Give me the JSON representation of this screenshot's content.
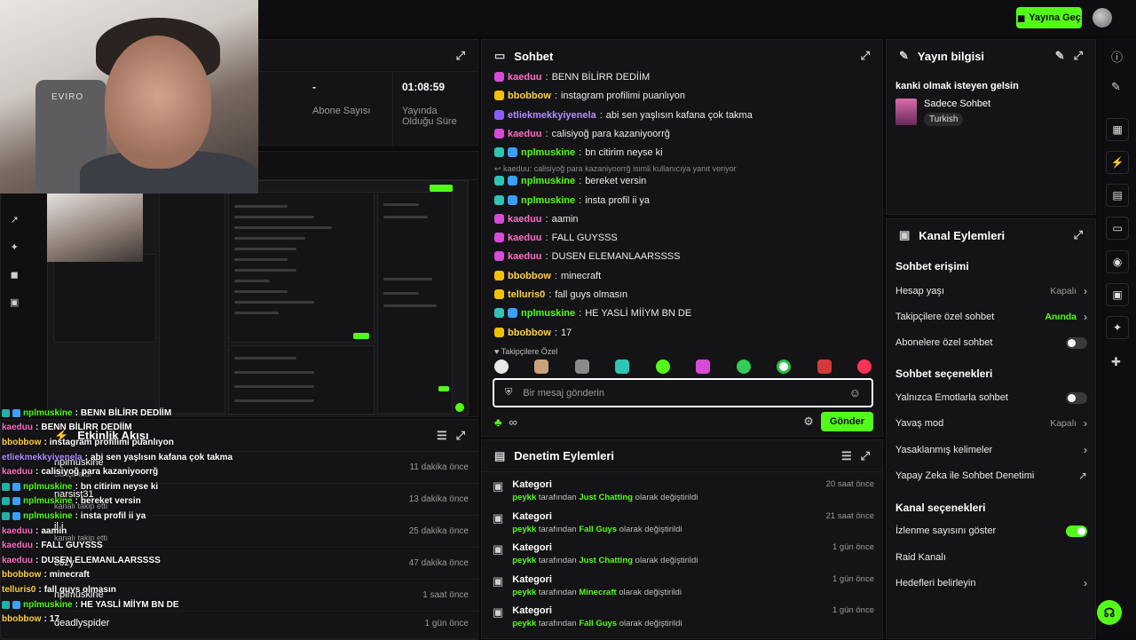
{
  "topbar": {
    "live_label": "Yayına Geç"
  },
  "webcam": {
    "chair_text": "EVIRO"
  },
  "stats": {
    "items": [
      {
        "value": "-",
        "label": "Abone Sayısı"
      },
      {
        "value": "01:08:59",
        "label": "Yayında Olduğu Süre"
      }
    ]
  },
  "activity": {
    "title": "Etkinlik Akışı",
    "rows": [
      {
        "user": "nplmuskine",
        "sub": "Su içir aldı",
        "time": "11 dakika önce"
      },
      {
        "user": "narsist31",
        "sub": "kanalı takip etti",
        "time": "13 dakika önce"
      },
      {
        "user": "il i",
        "sub": "kanalı takip etti",
        "time": "25 dakika önce"
      },
      {
        "user": "cozy",
        "sub": "",
        "time": "47 dakika önce"
      },
      {
        "user": "nplmuskine",
        "sub": "",
        "time": "1 saat önce"
      },
      {
        "user": "deadlyspider",
        "sub": "",
        "time": "1 gün önce"
      }
    ]
  },
  "overlay_chat": [
    {
      "user": "nplmuskine",
      "text": "BENN BİLİRR DEDİİM",
      "color": "#53fc18"
    },
    {
      "user": "kaeduu",
      "text": "BENN BİLİRR DEDİİM",
      "color": "#ff6ec7"
    },
    {
      "user": "bbobbow",
      "text": "instagram profilimi puanlıyon",
      "color": "#ffd24a"
    },
    {
      "user": "etliekmekkyiyenela",
      "text": "abi sen yaşlısın kafana çok takma",
      "color": "#b48cff"
    },
    {
      "user": "kaeduu",
      "text": "calisiyoğ para kazaniyoorrğ",
      "color": "#ff6ec7"
    },
    {
      "user": "nplmuskine",
      "text": "bn citirim neyse ki",
      "color": "#53fc18"
    },
    {
      "user": "nplmuskine",
      "text": "bereket versin",
      "color": "#53fc18"
    },
    {
      "user": "nplmuskine",
      "text": "insta profil ii ya",
      "color": "#53fc18"
    },
    {
      "user": "kaeduu",
      "text": "aamin",
      "color": "#ff6ec7"
    },
    {
      "user": "kaeduu",
      "text": "FALL GUYSSS",
      "color": "#ff6ec7"
    },
    {
      "user": "kaeduu",
      "text": "DUSEN ELEMANLAARSSSS",
      "color": "#ff6ec7"
    },
    {
      "user": "bbobbow",
      "text": "minecraft",
      "color": "#ffd24a"
    },
    {
      "user": "telluris0",
      "text": "fall guys olmasın",
      "color": "#ffd24a"
    },
    {
      "user": "nplmuskine",
      "text": "HE YASLİ MİİYM BN DE",
      "color": "#53fc18"
    },
    {
      "user": "bbobbow",
      "text": "17",
      "color": "#ffd24a"
    }
  ],
  "chat": {
    "title": "Sohbet",
    "messages": [
      {
        "user": "kaeduu",
        "text": "BENN BİLİRR DEDİİM",
        "color": "#ff6ec7",
        "badge": "pink"
      },
      {
        "user": "bbobbow",
        "text": "instagram profilimi puanlıyon",
        "color": "#ffd24a",
        "badge": "yellow"
      },
      {
        "user": "etliekmekkyiyenela",
        "text": "abi sen yaşlısın kafana çok takma",
        "color": "#b48cff",
        "badge": "purple"
      },
      {
        "user": "kaeduu",
        "text": "calisiyoğ para kazaniyoorrğ",
        "color": "#ff6ec7",
        "badge": "pink"
      },
      {
        "user": "nplmuskine",
        "text": "bn citirim neyse ki",
        "color": "#53fc18",
        "badge": "blue"
      },
      {
        "user": "nplmuskine",
        "text": "bereket versin",
        "color": "#53fc18",
        "badge": "blue"
      },
      {
        "user": "nplmuskine",
        "text": "insta profil ii ya",
        "color": "#53fc18",
        "badge": "blue"
      },
      {
        "user": "kaeduu",
        "text": "aamin",
        "color": "#ff6ec7",
        "badge": "pink"
      },
      {
        "user": "kaeduu",
        "text": "FALL GUYSSS",
        "color": "#ff6ec7",
        "badge": "pink"
      },
      {
        "user": "kaeduu",
        "text": "DUSEN ELEMANLAARSSSS",
        "color": "#ff6ec7",
        "badge": "pink"
      },
      {
        "user": "bbobbow",
        "text": "minecraft",
        "color": "#ffd24a",
        "badge": "yellow"
      },
      {
        "user": "telluris0",
        "text": "fall guys olmasın",
        "color": "#ffd24a",
        "badge": "yellow"
      },
      {
        "user": "nplmuskine",
        "text": "HE YASLİ MİİYM BN DE",
        "color": "#53fc18",
        "badge": "blue"
      },
      {
        "user": "bbobbow",
        "text": "17",
        "color": "#ffd24a",
        "badge": "yellow"
      }
    ],
    "reply_hint": "↩ kaeduu: calisiyoğ para kazaniyoorrğ isimli kullanıcıya yanıt veriyor",
    "pinned_label": "Takipçilere Özel",
    "input_placeholder": "Bir mesaj gönderin",
    "send_label": "Gönder"
  },
  "moderation": {
    "title": "Denetim Eylemleri",
    "rows": [
      {
        "title": "Kategori",
        "actor": "peykk",
        "middle": "tarafından",
        "category": "Just Chatting",
        "suffix": "olarak değiştirildi",
        "time": "20 saat önce"
      },
      {
        "title": "Kategori",
        "actor": "peykk",
        "middle": "tarafından",
        "category": "Fall Guys",
        "suffix": "olarak değiştirildi",
        "time": "21 saat önce"
      },
      {
        "title": "Kategori",
        "actor": "peykk",
        "middle": "tarafından",
        "category": "Just Chatting",
        "suffix": "olarak değiştirildi",
        "time": "1 gün önce"
      },
      {
        "title": "Kategori",
        "actor": "peykk",
        "middle": "tarafından",
        "category": "Minecraft",
        "suffix": "olarak değiştirildi",
        "time": "1 gün önce"
      },
      {
        "title": "Kategori",
        "actor": "peykk",
        "middle": "tarafından",
        "category": "Fall Guys",
        "suffix": "olarak değiştirildi",
        "time": "1 gün önce"
      }
    ]
  },
  "stream_info": {
    "title": "Yayın bilgisi",
    "stream_title": "kanki olmak isteyen gelsin",
    "category": "Sadece Sohbet",
    "tag": "Turkish"
  },
  "channel_actions": {
    "title": "Kanal Eylemleri",
    "chat_access": "Sohbet erişimi",
    "account_age": {
      "label": "Hesap yaşı",
      "value": "Kapalı"
    },
    "followers_only": {
      "label": "Takipçilere özel sohbet",
      "value": "Anında"
    },
    "subs_only": {
      "label": "Abonelere özel sohbet",
      "on": false
    },
    "chat_options": "Sohbet seçenekleri",
    "emotes_only": {
      "label": "Yalnızca Emotlarla sohbet",
      "on": false
    },
    "slow_mode": {
      "label": "Yavaş mod",
      "value": "Kapalı"
    },
    "banned_words": {
      "label": "Yasaklanmış kelimeler"
    },
    "ai_moderation": {
      "label": "Yapay Zeka ile Sohbet Denetimi"
    },
    "channel_options": "Kanal seçenekleri",
    "show_viewers": {
      "label": "İzlenme sayısını göster",
      "on": true
    },
    "raid": {
      "label": "Raid Kanalı"
    },
    "goals": {
      "label": "Hedefleri belirleyin"
    }
  },
  "colors": {
    "accent": "#53fc18",
    "panel": "#141416",
    "bg": "#0b0b0c"
  }
}
